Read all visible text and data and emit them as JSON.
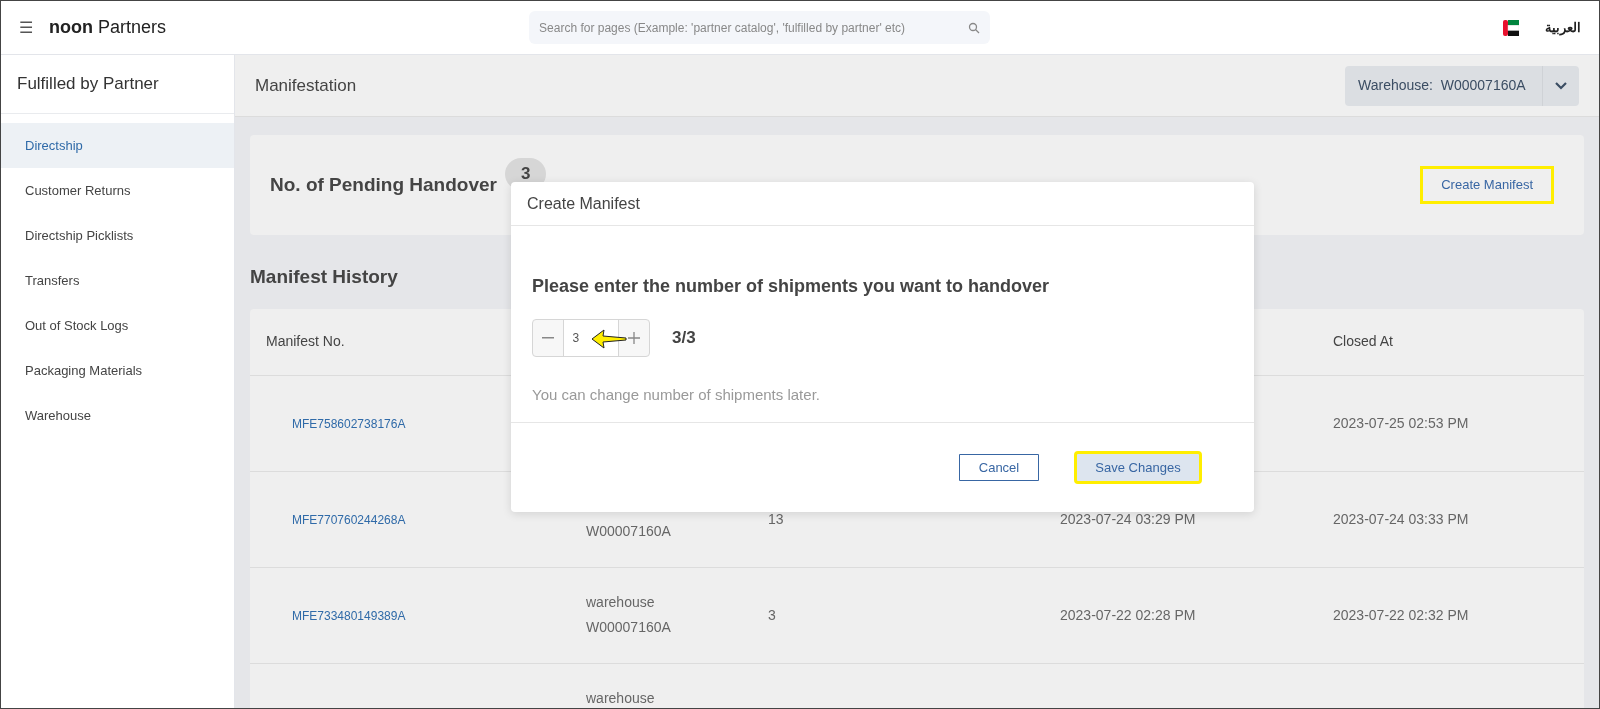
{
  "topbar": {
    "menu": "☰",
    "brand_bold": "noon",
    "brand_rest": "Partners",
    "search": {
      "placeholder": "Search for pages (Example: 'partner catalog', 'fulfilled by partner' etc)"
    },
    "language": "العربية"
  },
  "sidebar": {
    "title": "Fulfilled by Partner",
    "items": [
      {
        "label": "Directship",
        "selected": true
      },
      {
        "label": "Customer Returns",
        "selected": false
      },
      {
        "label": "Directship Picklists",
        "selected": false
      },
      {
        "label": "Transfers",
        "selected": false
      },
      {
        "label": "Out of Stock Logs",
        "selected": false
      },
      {
        "label": "Packaging Materials",
        "selected": false
      },
      {
        "label": "Warehouse",
        "selected": false
      }
    ]
  },
  "page": {
    "title": "Manifestation",
    "warehouse_select": {
      "label": "Warehouse:",
      "value": "W00007160A"
    }
  },
  "pending": {
    "label": "No. of Pending Handover",
    "count": "3",
    "button": {
      "label": "Create Manifest",
      "highlighted": true
    }
  },
  "history": {
    "title": "Manifest History",
    "columns": [
      "Manifest No.",
      "",
      "",
      "",
      "Closed At"
    ],
    "rows": [
      {
        "manifest_no": "MFE758602738176A",
        "closed_at": "2023-07-25 02:53 PM"
      },
      {
        "manifest_no": "MFE770760244268A",
        "column_2": {
          "line_2": "W00007160A"
        },
        "column_3": "13",
        "column_4": "2023-07-24 03:29 PM",
        "closed_at": "2023-07-24 03:33 PM"
      },
      {
        "manifest_no": "MFE733480149389A",
        "column_2": {
          "line_1": "warehouse",
          "line_2": "W00007160A"
        },
        "column_3": "3",
        "column_4": "2023-07-22 02:28 PM",
        "closed_at": "2023-07-22 02:32 PM"
      },
      {
        "column_2": {
          "line_1": "warehouse"
        }
      }
    ]
  },
  "dialog": {
    "title": "Create Manifest",
    "question": "Please enter the number of shipments you want to handover",
    "stepper": {
      "value": "3"
    },
    "ratio": "3/3",
    "hint": "You can change number of shipments later.",
    "buttons": [
      {
        "kind": "outline",
        "label": "Cancel",
        "highlighted": false
      },
      {
        "kind": "primary",
        "label": "Save Changes",
        "highlighted": true
      }
    ]
  }
}
